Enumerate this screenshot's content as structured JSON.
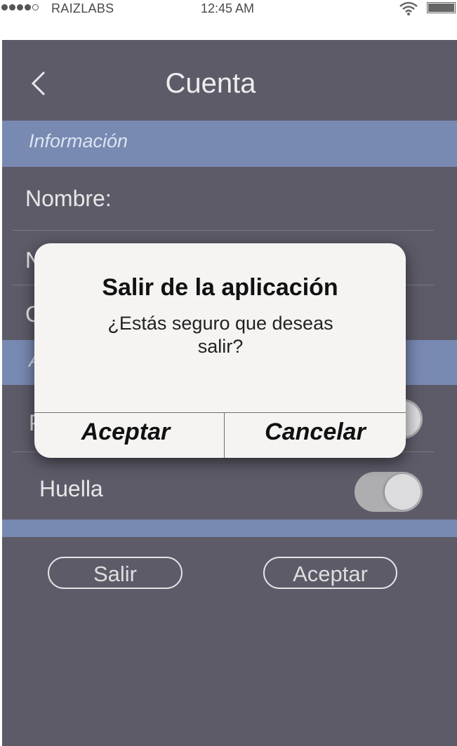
{
  "status_bar": {
    "carrier": "RAIZLABS",
    "time": "12:45 AM",
    "signal_bars_filled": 4,
    "signal_bars_total": 5,
    "battery_level": 1.0
  },
  "header": {
    "title": "Cuenta",
    "back_icon": "chevron-left-icon"
  },
  "sections": {
    "info_label": "Información",
    "fields": [
      "Nombre:",
      "N",
      "C"
    ],
    "section2_label_partial": "A",
    "toggle_rows": [
      {
        "label": "P",
        "on": true
      },
      {
        "label": "Huella",
        "on": true
      }
    ]
  },
  "actions": {
    "exit_label": "Salir",
    "accept_label": "Aceptar"
  },
  "alert": {
    "title": "Salir de la aplicación",
    "message": "¿Estás seguro que deseas salir?",
    "confirm_label": "Aceptar",
    "cancel_label": "Cancelar"
  },
  "colors": {
    "screen_bg": "#5e5b69",
    "section_bar": "#7889b2",
    "alert_bg": "#f5f4f2"
  }
}
